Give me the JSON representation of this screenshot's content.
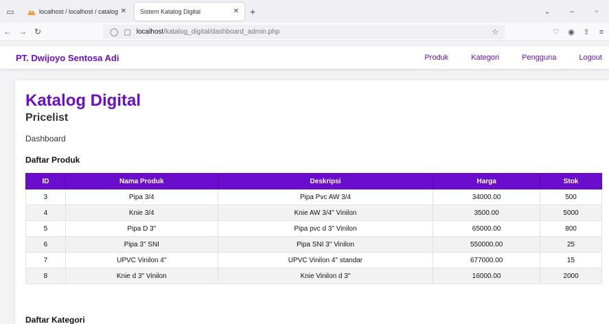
{
  "browser": {
    "tabs": [
      {
        "title": "localhost / localhost / catalog_d",
        "active": false
      },
      {
        "title": "Sistem Katalog Digital",
        "active": true
      }
    ],
    "url_host": "localhost",
    "url_path": "/katalog_digital/dashboard_admin.php"
  },
  "header": {
    "brand": "PT. Dwijoyo Sentosa Adi",
    "menu": [
      "Produk",
      "Kategori",
      "Pengguna",
      "Logout"
    ]
  },
  "main": {
    "title": "Katalog Digital",
    "subtitle": "Pricelist",
    "dashboard": "Dashboard",
    "products_heading": "Daftar Produk",
    "categories_heading": "Daftar Kategori",
    "columns": [
      "ID",
      "Nama Produk",
      "Deskripsi",
      "Harga",
      "Stok"
    ],
    "rows": [
      [
        "3",
        "Pipa 3/4",
        "Pipa Pvc AW 3/4",
        "34000.00",
        "500"
      ],
      [
        "4",
        "Knie 3/4",
        "Knie AW 3/4\" Vinilon",
        "3500.00",
        "5000"
      ],
      [
        "5",
        "Pipa D 3\"",
        "Pipa pvc d 3\" Vinilon",
        "65000.00",
        "800"
      ],
      [
        "6",
        "Pipa 3\" SNI",
        "Pipa SNI 3\" Vinilon",
        "550000.00",
        "25"
      ],
      [
        "7",
        "UPVC Vinilon 4\"",
        "UPVC Vinilon 4\" standar",
        "677000.00",
        "15"
      ],
      [
        "8",
        "Knie d 3\" Vinilon",
        "Knie Vinilon d 3\"",
        "16000.00",
        "2000"
      ]
    ]
  },
  "colors": {
    "accent": "#6a0dcc"
  }
}
